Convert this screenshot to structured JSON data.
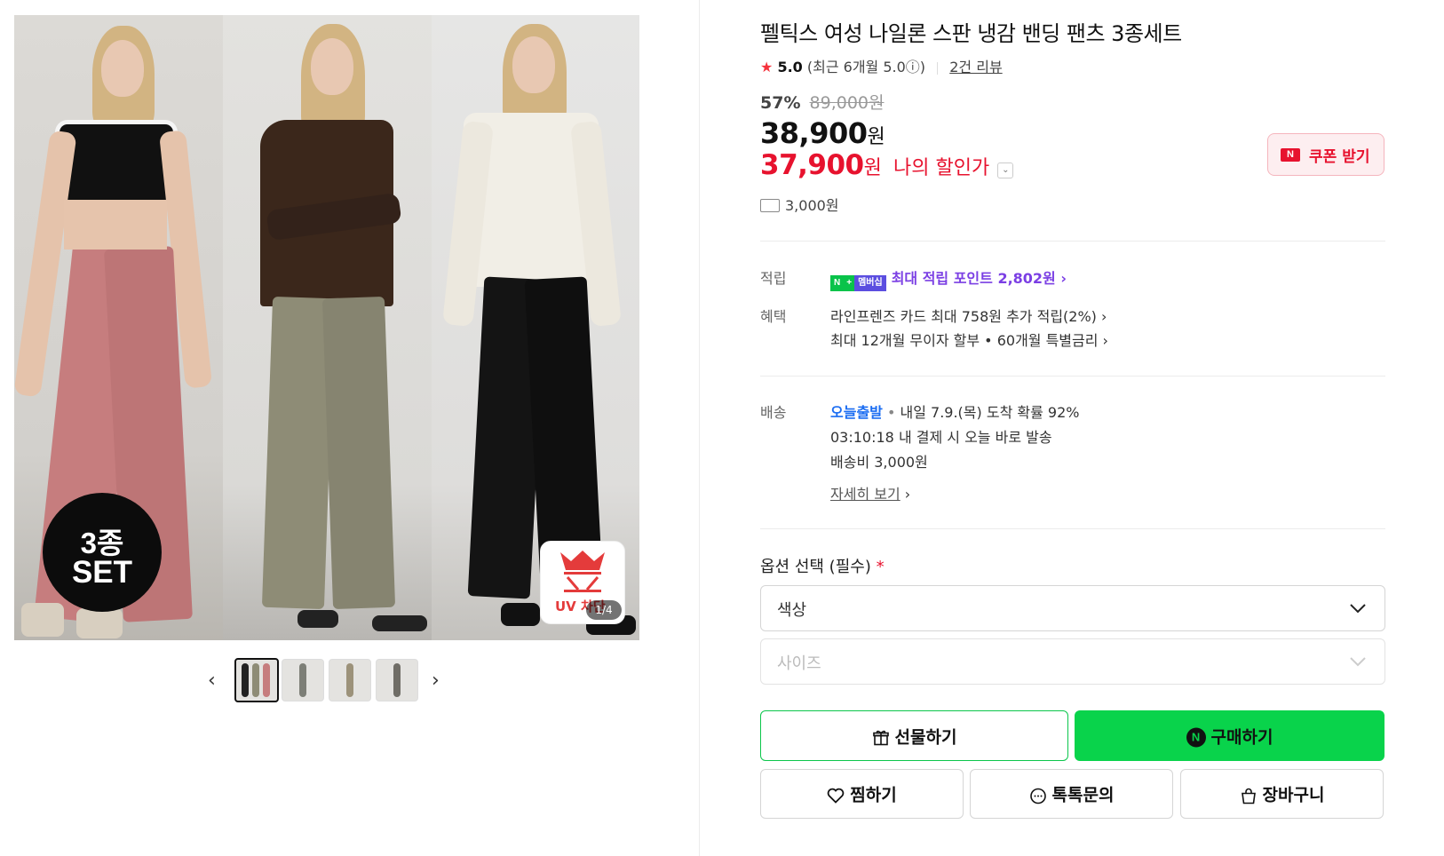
{
  "gallery": {
    "badge_line1": "3종",
    "badge_line2": "SET",
    "uv_label": "UV 차단",
    "counter": "1/4"
  },
  "product": {
    "title": "펠틱스 여성 나일론 스판 냉감 밴딩 팬츠 3종세트",
    "star": "★",
    "rating": "5.0",
    "rating_recent": "(최근 6개월 5.0ⓘ)",
    "review_count": "2건 리뷰",
    "discount_pct": "57%",
    "original_price": "89,000원",
    "price": "38,900",
    "price_unit": "원",
    "my_price": "37,900",
    "my_price_unit": "원",
    "my_price_label": "나의 할인가",
    "coupon_label": "쿠폰 받기",
    "shipping_fee": "3,000원"
  },
  "benefits": {
    "points_label": "적립",
    "points_badge_n": "N",
    "points_badge_plus": "+",
    "points_badge_member": "멤버십",
    "points_text": "최대 적립 포인트 2,802원 ›",
    "perks_label": "혜택",
    "perk1": "라인프렌즈 카드 최대 758원 추가 적립(2%) ›",
    "perk2": "최대 12개월 무이자 할부 • 60개월 특별금리 ›"
  },
  "delivery": {
    "label": "배송",
    "today": "오늘출발",
    "dot": " • ",
    "arrival": "내일 7.9.(목) 도착 확률 92%",
    "countdown": "03:10:18",
    "countdown_text": "내 결제 시 오늘 바로 발송",
    "fee": "배송비 3,000원",
    "details_link": "자세히 보기",
    "details_chev": "›"
  },
  "options": {
    "title": "옵션 선택 (필수)",
    "required_mark": "*",
    "color_select": "색상",
    "size_select": "사이즈"
  },
  "actions": {
    "gift": "선물하기",
    "buy": "구매하기",
    "wish": "찜하기",
    "talk": "톡톡문의",
    "cart": "장바구니"
  },
  "colors": {
    "accent_green": "#09d34b",
    "sale_red": "#e7122e",
    "points_purple": "#7b3fe4",
    "link_blue": "#1b6df2"
  }
}
